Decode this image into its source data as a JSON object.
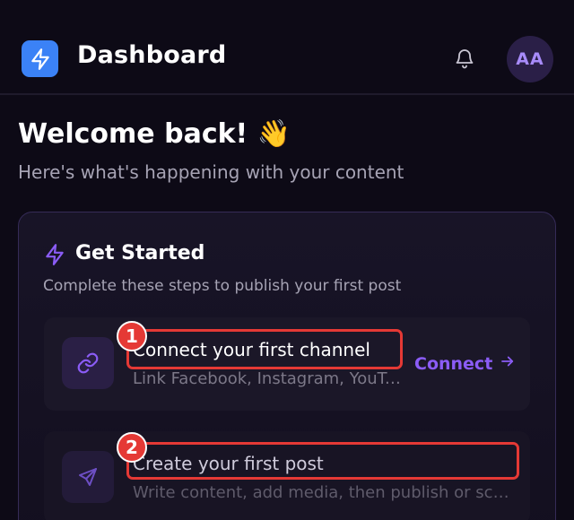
{
  "header": {
    "app_title": "Dashboard",
    "avatar_initials": "AA",
    "icons": {
      "logo": "lightning-bolt-icon",
      "notifications": "bell-icon"
    }
  },
  "welcome": {
    "title": "Welcome back! 👋",
    "subtitle": "Here's what's happening with your content"
  },
  "get_started": {
    "title": "Get Started",
    "subtitle": "Complete these steps to publish your first post",
    "steps": [
      {
        "title": "Connect your first channel",
        "description": "Link Facebook, Instagram, YouTube and more",
        "action_label": "Connect",
        "icon": "link-icon"
      },
      {
        "title": "Create your first post",
        "description": "Write content, add media, then publish or schedule",
        "icon": "send-icon"
      }
    ]
  },
  "annotations": {
    "callout_1": "1",
    "callout_2": "2"
  },
  "colors": {
    "background": "#0d0a16",
    "accent": "#8b5cf6",
    "logo": "#3b82f6",
    "callout": "#e53935"
  }
}
